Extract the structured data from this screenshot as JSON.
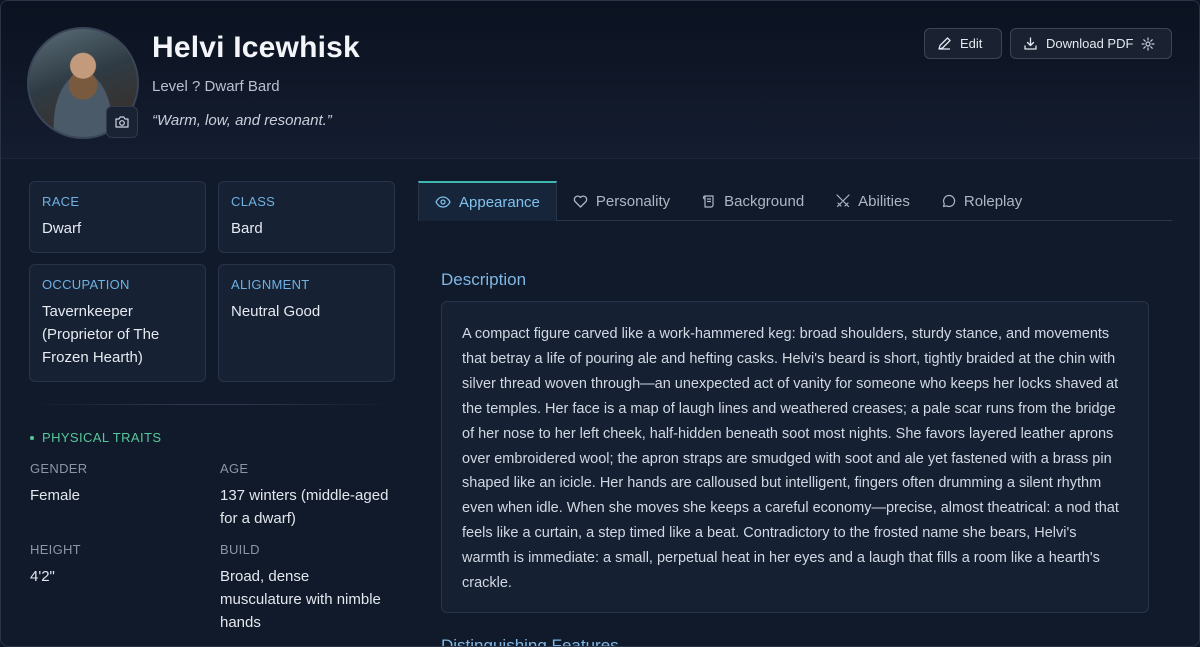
{
  "header": {
    "name": "Helvi Icewhisk",
    "subtitle": "Level ? Dwarf Bard",
    "quote": "“Warm, low, and resonant.”",
    "avatar_icon": "character-portrait",
    "camera_icon": "camera-icon",
    "edit_label": "Edit",
    "download_label": "Download PDF"
  },
  "cards": {
    "race": {
      "label": "RACE",
      "value": "Dwarf"
    },
    "class": {
      "label": "CLASS",
      "value": "Bard"
    },
    "occupation": {
      "label": "OCCUPATION",
      "value": "Tavernkeeper (Proprietor of The Frozen Hearth)"
    },
    "alignment": {
      "label": "ALIGNMENT",
      "value": "Neutral Good"
    }
  },
  "physical": {
    "title": "PHYSICAL TRAITS",
    "gender": {
      "label": "GENDER",
      "value": "Female"
    },
    "age": {
      "label": "AGE",
      "value": "137 winters (middle-aged for a dwarf)"
    },
    "height": {
      "label": "HEIGHT",
      "value": "4'2\""
    },
    "build": {
      "label": "BUILD",
      "value": "Broad, dense musculature with nimble hands"
    }
  },
  "tabs": [
    {
      "label": "Appearance",
      "icon": "eye-icon"
    },
    {
      "label": "Personality",
      "icon": "heart-icon"
    },
    {
      "label": "Background",
      "icon": "scroll-icon"
    },
    {
      "label": "Abilities",
      "icon": "swords-icon"
    },
    {
      "label": "Roleplay",
      "icon": "chat-icon"
    }
  ],
  "main": {
    "description_heading": "Description",
    "description": "A compact figure carved like a work-hammered keg: broad shoulders, sturdy stance, and movements that betray a life of pouring ale and hefting casks. Helvi's beard is short, tightly braided at the chin with silver thread woven through—an unexpected act of vanity for someone who keeps her locks shaved at the temples. Her face is a map of laugh lines and weathered creases; a pale scar runs from the bridge of her nose to her left cheek, half-hidden beneath soot most nights. She favors layered leather aprons over embroidered wool; the apron straps are smudged with soot and ale yet fastened with a brass pin shaped like an icicle. Her hands are calloused but intelligent, fingers often drumming a silent rhythm even when idle. When she moves she keeps a careful economy—precise, almost theatrical: a nod that feels like a curtain, a step timed like a beat. Contradictory to the frosted name she bears, Helvi's warmth is immediate: a small, perpetual heat in her eyes and a laugh that fills a room like a hearth's crackle.",
    "features_heading": "Distinguishing Features"
  },
  "colors": {
    "accent": "#7fc2ef",
    "tab_active_border": "#3fb6b0",
    "traits_green": "#56c79a",
    "card_label_blue": "#6fb1e3"
  }
}
